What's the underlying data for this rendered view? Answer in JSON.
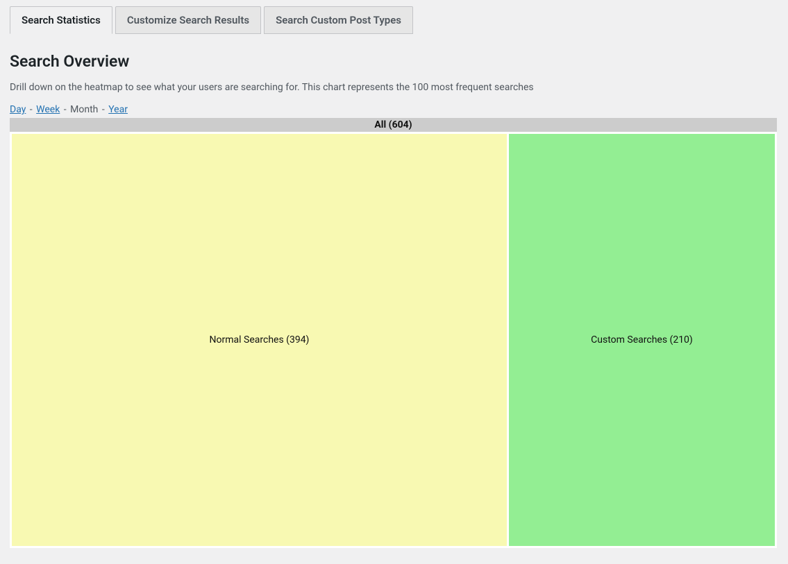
{
  "tabs": [
    {
      "label": "Search Statistics"
    },
    {
      "label": "Customize Search Results"
    },
    {
      "label": "Search Custom Post Types"
    }
  ],
  "active_tab_index": 0,
  "heading": "Search Overview",
  "description": "Drill down on the heatmap to see what your users are searching for. This chart represents the 100 most frequent searches",
  "range": {
    "sep": " - ",
    "items": [
      {
        "label": "Day",
        "active": false,
        "link": true
      },
      {
        "label": "Week",
        "active": false,
        "link": true
      },
      {
        "label": "Month",
        "active": true,
        "link": false
      },
      {
        "label": "Year",
        "active": false,
        "link": true
      }
    ]
  },
  "chart_data": {
    "type": "heatmap",
    "title": "All (604)",
    "total": 604,
    "series": [
      {
        "name": "Normal Searches",
        "value": 394,
        "color": "#f8f9b2",
        "label": "Normal Searches (394)"
      },
      {
        "name": "Custom Searches",
        "value": 210,
        "color": "#93ee93",
        "label": "Custom Searches (210)"
      }
    ]
  }
}
